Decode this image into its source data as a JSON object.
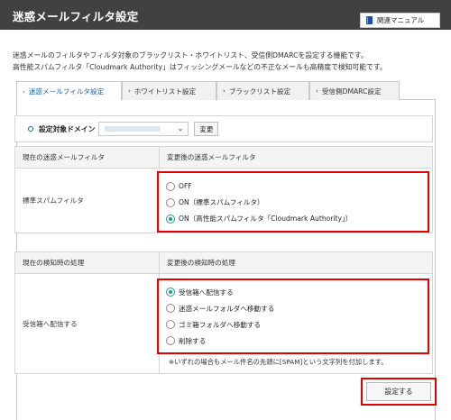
{
  "header": {
    "title": "迷惑メールフィルタ設定",
    "manual_label": "関連マニュアル",
    "manual_icon": "book-icon"
  },
  "description": {
    "line1": "迷惑メールのフィルタやフィルタ対象のブラックリスト・ホワイトリスト、受信側DMARCを設定する機能です。",
    "line2": "高性能スパムフィルタ「Cloudmark Authority」はフィッシングメールなどの不正なメールも高精度で検知可能です。"
  },
  "tabs": [
    {
      "label": "迷惑メールフィルタ設定",
      "active": true
    },
    {
      "label": "ホワイトリスト設定",
      "active": false
    },
    {
      "label": "ブラックリスト設定",
      "active": false
    },
    {
      "label": "受信側DMARC設定",
      "active": false
    }
  ],
  "domain": {
    "label": "設定対象ドメイン",
    "change_label": "変更"
  },
  "filter_table": {
    "header_current": "現在の迷惑メールフィルタ",
    "header_after": "変更後の迷惑メールフィルタ",
    "current_value": "標準スパムフィルタ",
    "options": [
      {
        "label": "OFF",
        "selected": false
      },
      {
        "label": "ON（標準スパムフィルタ）",
        "selected": false
      },
      {
        "label": "ON（高性能スパムフィルタ「Cloudmark Authority」）",
        "selected": true
      }
    ]
  },
  "action_table": {
    "header_current": "現在の検知時の処理",
    "header_after": "変更後の検知時の処理",
    "current_value": "受信箱へ配信する",
    "options": [
      {
        "label": "受信箱へ配信する",
        "selected": true
      },
      {
        "label": "迷惑メールフォルダへ移動する",
        "selected": false
      },
      {
        "label": "ゴミ箱フォルダへ移動する",
        "selected": false
      },
      {
        "label": "削除する",
        "selected": false
      }
    ],
    "note": "※いずれの場合もメール件名の先頭に[SPAM]という文字列を付加します。"
  },
  "submit_label": "設定する",
  "colors": {
    "header_bg": "#3f4143",
    "highlight": "#e30000",
    "radio_selected": "#1aa08a",
    "active_tab": "#1d5fa8"
  }
}
